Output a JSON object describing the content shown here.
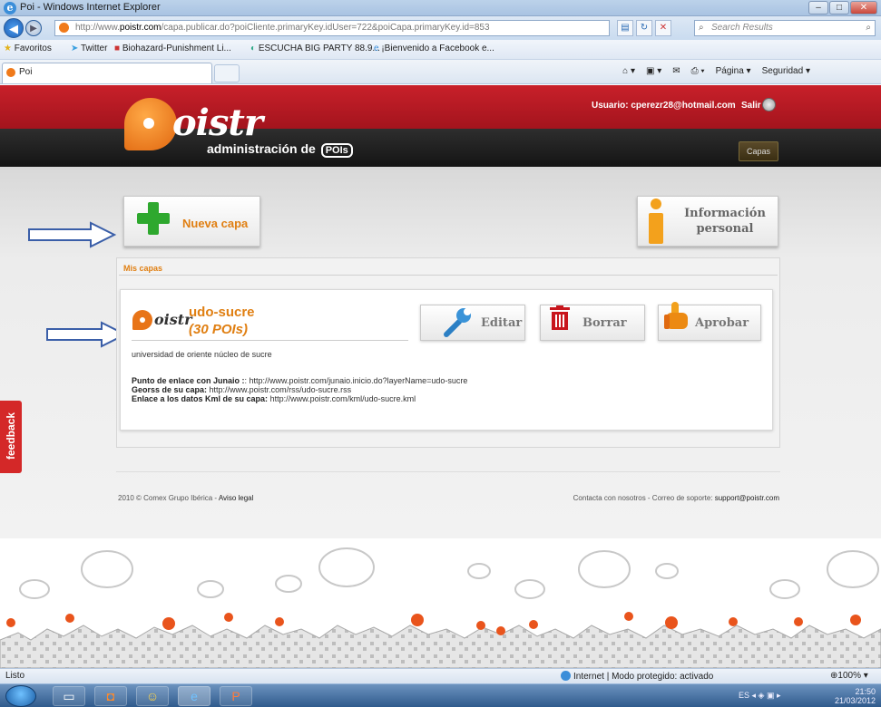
{
  "window": {
    "title": "Poi - Windows Internet Explorer"
  },
  "address": {
    "url_prefix": "http://www.",
    "url_domain": "poistr.com",
    "url_rest": "/capa.publicar.do?poiCliente.primaryKey.idUser=722&poiCapa.primaryKey.id=853",
    "search_placeholder": "Search Results"
  },
  "favorites": {
    "label": "Favoritos",
    "items": [
      "Twitter",
      "Biohazard-Punishment Li...",
      "ESCUCHA BIG PARTY 88.9...",
      "¡Bienvenido a Facebook e..."
    ]
  },
  "tab": {
    "title": "Poi"
  },
  "commandbar": {
    "pagina": "Página",
    "seguridad": "Seguridad"
  },
  "site": {
    "logo": "oistr",
    "admin_label": "administración de",
    "admin_badge": "POIs",
    "user": "Usuario: cperezr28@hotmail.com",
    "salir": "Salir",
    "capas_tab": "Capas",
    "nueva_capa": "Nueva capa",
    "info_line1": "Información",
    "info_line2": "personal",
    "mis_capas": "Mis capas",
    "feedback": "feedback"
  },
  "capa": {
    "logo_text": "oistr",
    "name": "udo-sucre",
    "count": "(30 POIs)",
    "description": "universidad de oriente núcleo de sucre",
    "link1_label": "Punto de enlace con Junaio :",
    "link1_value": ": http://www.poistr.com/junaio.inicio.do?layerName=udo-sucre",
    "link2_label": "Georss de su capa:",
    "link2_value": " http://www.poistr.com/rss/udo-sucre.rss",
    "link3_label": "Enlace a los datos Kml de su capa:",
    "link3_value": " http://www.poistr.com/kml/udo-sucre.kml",
    "editar": "Editar",
    "borrar": "Borrar",
    "aprobar": "Aprobar"
  },
  "footer": {
    "copyright": "2010 © Comex Grupo Ibérica - ",
    "aviso": "Aviso legal",
    "contact": "Contacta con nosotros - Correo de soporte: ",
    "email": "support@poistr.com"
  },
  "status": {
    "left": "Listo",
    "zone": "Internet | Modo protegido: activado",
    "zoom": "100%"
  },
  "tray": {
    "lang": "ES",
    "time": "21:50",
    "date": "21/03/2012"
  },
  "colors": {
    "accent_orange": "#e07f12",
    "header_red": "#b81a23",
    "feedback_red": "#d42828",
    "plus_green": "#2ea82e"
  }
}
